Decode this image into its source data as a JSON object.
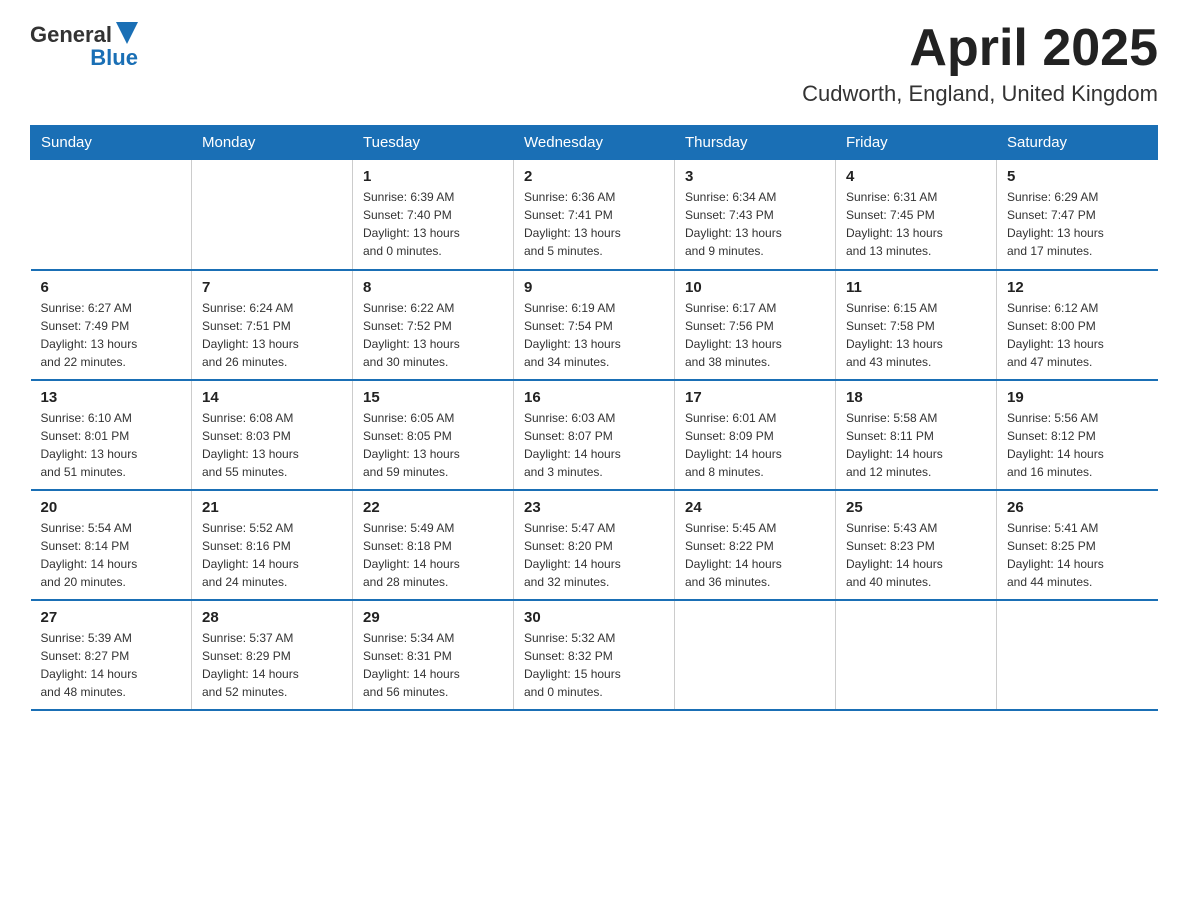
{
  "logo": {
    "general": "General",
    "blue": "Blue"
  },
  "title": "April 2025",
  "subtitle": "Cudworth, England, United Kingdom",
  "weekdays": [
    "Sunday",
    "Monday",
    "Tuesday",
    "Wednesday",
    "Thursday",
    "Friday",
    "Saturday"
  ],
  "weeks": [
    [
      {
        "day": "",
        "info": ""
      },
      {
        "day": "",
        "info": ""
      },
      {
        "day": "1",
        "info": "Sunrise: 6:39 AM\nSunset: 7:40 PM\nDaylight: 13 hours\nand 0 minutes."
      },
      {
        "day": "2",
        "info": "Sunrise: 6:36 AM\nSunset: 7:41 PM\nDaylight: 13 hours\nand 5 minutes."
      },
      {
        "day": "3",
        "info": "Sunrise: 6:34 AM\nSunset: 7:43 PM\nDaylight: 13 hours\nand 9 minutes."
      },
      {
        "day": "4",
        "info": "Sunrise: 6:31 AM\nSunset: 7:45 PM\nDaylight: 13 hours\nand 13 minutes."
      },
      {
        "day": "5",
        "info": "Sunrise: 6:29 AM\nSunset: 7:47 PM\nDaylight: 13 hours\nand 17 minutes."
      }
    ],
    [
      {
        "day": "6",
        "info": "Sunrise: 6:27 AM\nSunset: 7:49 PM\nDaylight: 13 hours\nand 22 minutes."
      },
      {
        "day": "7",
        "info": "Sunrise: 6:24 AM\nSunset: 7:51 PM\nDaylight: 13 hours\nand 26 minutes."
      },
      {
        "day": "8",
        "info": "Sunrise: 6:22 AM\nSunset: 7:52 PM\nDaylight: 13 hours\nand 30 minutes."
      },
      {
        "day": "9",
        "info": "Sunrise: 6:19 AM\nSunset: 7:54 PM\nDaylight: 13 hours\nand 34 minutes."
      },
      {
        "day": "10",
        "info": "Sunrise: 6:17 AM\nSunset: 7:56 PM\nDaylight: 13 hours\nand 38 minutes."
      },
      {
        "day": "11",
        "info": "Sunrise: 6:15 AM\nSunset: 7:58 PM\nDaylight: 13 hours\nand 43 minutes."
      },
      {
        "day": "12",
        "info": "Sunrise: 6:12 AM\nSunset: 8:00 PM\nDaylight: 13 hours\nand 47 minutes."
      }
    ],
    [
      {
        "day": "13",
        "info": "Sunrise: 6:10 AM\nSunset: 8:01 PM\nDaylight: 13 hours\nand 51 minutes."
      },
      {
        "day": "14",
        "info": "Sunrise: 6:08 AM\nSunset: 8:03 PM\nDaylight: 13 hours\nand 55 minutes."
      },
      {
        "day": "15",
        "info": "Sunrise: 6:05 AM\nSunset: 8:05 PM\nDaylight: 13 hours\nand 59 minutes."
      },
      {
        "day": "16",
        "info": "Sunrise: 6:03 AM\nSunset: 8:07 PM\nDaylight: 14 hours\nand 3 minutes."
      },
      {
        "day": "17",
        "info": "Sunrise: 6:01 AM\nSunset: 8:09 PM\nDaylight: 14 hours\nand 8 minutes."
      },
      {
        "day": "18",
        "info": "Sunrise: 5:58 AM\nSunset: 8:11 PM\nDaylight: 14 hours\nand 12 minutes."
      },
      {
        "day": "19",
        "info": "Sunrise: 5:56 AM\nSunset: 8:12 PM\nDaylight: 14 hours\nand 16 minutes."
      }
    ],
    [
      {
        "day": "20",
        "info": "Sunrise: 5:54 AM\nSunset: 8:14 PM\nDaylight: 14 hours\nand 20 minutes."
      },
      {
        "day": "21",
        "info": "Sunrise: 5:52 AM\nSunset: 8:16 PM\nDaylight: 14 hours\nand 24 minutes."
      },
      {
        "day": "22",
        "info": "Sunrise: 5:49 AM\nSunset: 8:18 PM\nDaylight: 14 hours\nand 28 minutes."
      },
      {
        "day": "23",
        "info": "Sunrise: 5:47 AM\nSunset: 8:20 PM\nDaylight: 14 hours\nand 32 minutes."
      },
      {
        "day": "24",
        "info": "Sunrise: 5:45 AM\nSunset: 8:22 PM\nDaylight: 14 hours\nand 36 minutes."
      },
      {
        "day": "25",
        "info": "Sunrise: 5:43 AM\nSunset: 8:23 PM\nDaylight: 14 hours\nand 40 minutes."
      },
      {
        "day": "26",
        "info": "Sunrise: 5:41 AM\nSunset: 8:25 PM\nDaylight: 14 hours\nand 44 minutes."
      }
    ],
    [
      {
        "day": "27",
        "info": "Sunrise: 5:39 AM\nSunset: 8:27 PM\nDaylight: 14 hours\nand 48 minutes."
      },
      {
        "day": "28",
        "info": "Sunrise: 5:37 AM\nSunset: 8:29 PM\nDaylight: 14 hours\nand 52 minutes."
      },
      {
        "day": "29",
        "info": "Sunrise: 5:34 AM\nSunset: 8:31 PM\nDaylight: 14 hours\nand 56 minutes."
      },
      {
        "day": "30",
        "info": "Sunrise: 5:32 AM\nSunset: 8:32 PM\nDaylight: 15 hours\nand 0 minutes."
      },
      {
        "day": "",
        "info": ""
      },
      {
        "day": "",
        "info": ""
      },
      {
        "day": "",
        "info": ""
      }
    ]
  ]
}
